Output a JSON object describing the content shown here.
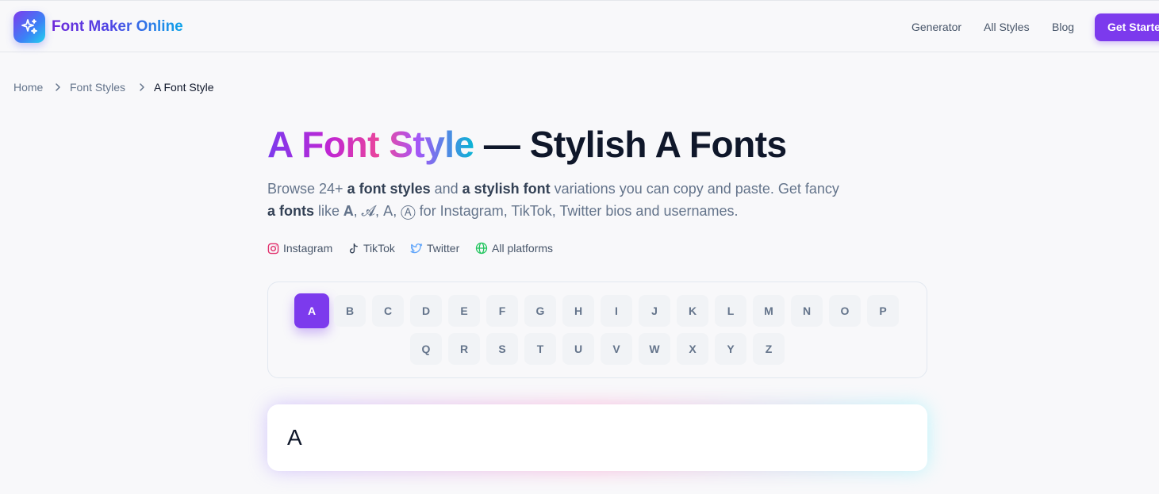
{
  "header": {
    "brand": "Font Maker Online",
    "nav": [
      "Generator",
      "All Styles",
      "Blog"
    ],
    "cta": "Get Started"
  },
  "breadcrumb": [
    "Home",
    "Font Styles",
    "A Font Style"
  ],
  "hero": {
    "title_gradient": "A Font Style",
    "title_rest": " — Stylish A Fonts",
    "desc": {
      "p1": "Browse 24+ ",
      "b1": "a font styles",
      "p2": " and ",
      "b2": "a stylish font",
      "p3": " variations you can copy and paste. Get fancy",
      "b3": "a fonts",
      "p4": " like 𝐀, 𝓐, 𝖠, Ⓐ for Instagram, TikTok, Twitter bios and usernames."
    }
  },
  "platforms": [
    "Instagram",
    "TikTok",
    "Twitter",
    "All platforms"
  ],
  "letters": {
    "row1": [
      "A",
      "B",
      "C",
      "D",
      "E",
      "F",
      "G",
      "H",
      "I",
      "J",
      "K",
      "L",
      "M",
      "N",
      "O",
      "P"
    ],
    "row2": [
      "Q",
      "R",
      "S",
      "T",
      "U",
      "V",
      "W",
      "X",
      "Y",
      "Z"
    ],
    "selected": "A"
  },
  "input": {
    "value": "A"
  },
  "colors": {
    "accent": "#7c3aed",
    "instagram": "#e1306c",
    "twitter": "#60a5fa",
    "globe": "#22c55e"
  }
}
